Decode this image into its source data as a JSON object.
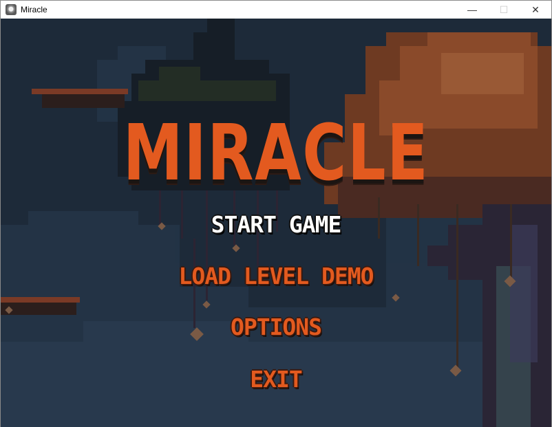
{
  "window": {
    "title": "Miracle",
    "minimize_glyph": "—",
    "maximize_glyph": "☐",
    "close_glyph": "✕"
  },
  "game": {
    "logo": "MIRACLE",
    "menu": [
      {
        "label": "START GAME",
        "selected": true
      },
      {
        "label": "LOAD LEVEL DEMO",
        "selected": false
      },
      {
        "label": "OPTIONS",
        "selected": false
      },
      {
        "label": "EXIT",
        "selected": false
      }
    ]
  },
  "colors": {
    "accent": "#e35a1f",
    "selected_text": "#ffffff",
    "sky": "#1d2a39"
  }
}
